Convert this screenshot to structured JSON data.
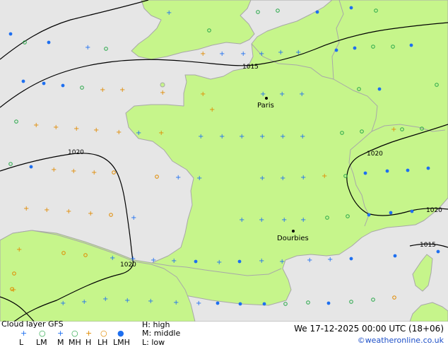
{
  "legend": {
    "title": "Cloud layer GFS",
    "symbols": [
      {
        "code": "L",
        "icon": "blue-plus-icon",
        "color": "#1e6ff0"
      },
      {
        "code": "LM",
        "icon": "blue-ring-icon",
        "color": "#2aa84a"
      },
      {
        "code": "M",
        "icon": "blue-plus-icon",
        "color": "#1e6ff0"
      },
      {
        "code": "MH",
        "icon": "blue-ring-icon",
        "color": "#2aa84a"
      },
      {
        "code": "H",
        "icon": "orange-plus-icon",
        "color": "#e08a00"
      },
      {
        "code": "LH",
        "icon": "orange-ring-icon",
        "color": "#e08a00"
      },
      {
        "code": "LMH",
        "icon": "blue-dot-icon",
        "color": "#1e6ff0"
      }
    ],
    "key_high": "H: high",
    "key_middle": "M: middle",
    "key_low": "L: low",
    "datetime": "We 17-12-2025 00:00 UTC (18+06)",
    "credit": "©weatheronline.co.uk"
  },
  "map": {
    "colors": {
      "land": "#c6f58b",
      "sea": "#e6e6e6",
      "isobar": "#000000",
      "border": "#a8a8a8"
    },
    "cities": [
      {
        "name": "Paris",
        "lat": 48.86,
        "lon": 2.35
      },
      {
        "name": "Dourbies",
        "lat": 44.07,
        "lon": 3.45
      }
    ],
    "isobars": [
      {
        "label": "1015"
      },
      {
        "label": "1020"
      },
      {
        "label": "1020"
      },
      {
        "label": "1020"
      },
      {
        "label": "1020"
      },
      {
        "label": "1015"
      }
    ]
  }
}
